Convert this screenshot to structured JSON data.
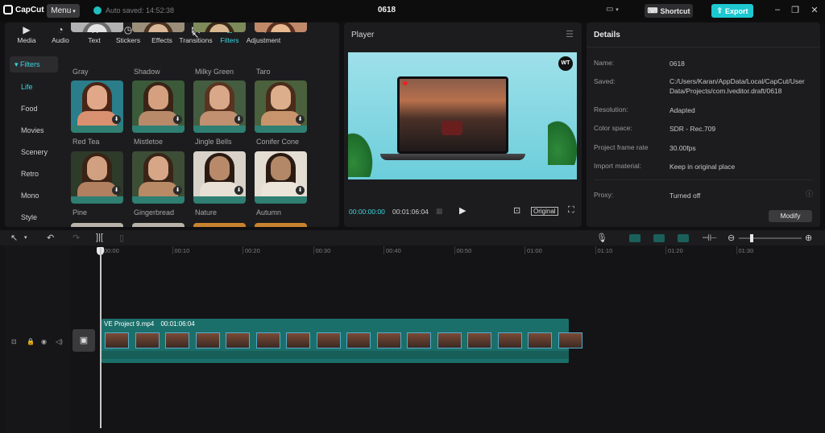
{
  "app": {
    "logo_text": "CapCut",
    "menu_label": "Menu",
    "autosave_text": "Auto saved: 14:52:38",
    "project_title": "0618",
    "shortcut_label": "Shortcut",
    "export_label": "Export"
  },
  "tabs": [
    {
      "label": "Media",
      "icon": "media-icon"
    },
    {
      "label": "Audio",
      "icon": "audio-icon"
    },
    {
      "label": "Text",
      "icon": "text-icon"
    },
    {
      "label": "Stickers",
      "icon": "sticker-icon"
    },
    {
      "label": "Effects",
      "icon": "effects-icon"
    },
    {
      "label": "Transitions",
      "icon": "transitions-icon"
    },
    {
      "label": "Filters",
      "icon": "filters-icon"
    },
    {
      "label": "Adjustment",
      "icon": "adjustment-icon"
    }
  ],
  "active_tab": "Filters",
  "filter_categories": {
    "header": "Filters",
    "items": [
      "Life",
      "Food",
      "Movies",
      "Scenery",
      "Retro",
      "Mono",
      "Style"
    ],
    "active": "Life"
  },
  "filters": [
    {
      "label": "Gray"
    },
    {
      "label": "Shadow"
    },
    {
      "label": "Milky Green"
    },
    {
      "label": "Taro"
    },
    {
      "label": "Red Tea"
    },
    {
      "label": "Mistletoe"
    },
    {
      "label": "Jingle Bells"
    },
    {
      "label": "Conifer Cone"
    },
    {
      "label": "Pine"
    },
    {
      "label": "Gingerbread"
    },
    {
      "label": "Nature"
    },
    {
      "label": "Autumn"
    }
  ],
  "player": {
    "title": "Player",
    "watermark": "WT",
    "current_time": "00:00:00:00",
    "total_time": "00:01:06:04",
    "ratio_label": "Original"
  },
  "details": {
    "title": "Details",
    "rows": [
      {
        "key": "Name:",
        "value": "0618"
      },
      {
        "key": "Saved:",
        "value": "C:/Users/Karan/AppData/Local/CapCut/User Data/Projects/com.lveditor.draft/0618"
      },
      {
        "key": "Resolution:",
        "value": "Adapted"
      },
      {
        "key": "Color space:",
        "value": "SDR - Rec.709"
      },
      {
        "key": "Project frame rate",
        "value": "30.00fps"
      },
      {
        "key": "Import material:",
        "value": "Keep in original place"
      },
      {
        "key": "Proxy:",
        "value": "Turned off"
      }
    ],
    "modify_label": "Modify"
  },
  "timeline": {
    "ruler": [
      "00:00",
      "00:10",
      "00:20",
      "00:30",
      "00:40",
      "00:50",
      "01:00",
      "01:10",
      "01:20",
      "01:30"
    ],
    "clip_name": "VE Project 9.mp4",
    "clip_duration": "00:01:06:04"
  },
  "colors": {
    "accent": "#1ec8d0",
    "clip": "#1b6f6a",
    "panel": "#1c1c1e"
  }
}
